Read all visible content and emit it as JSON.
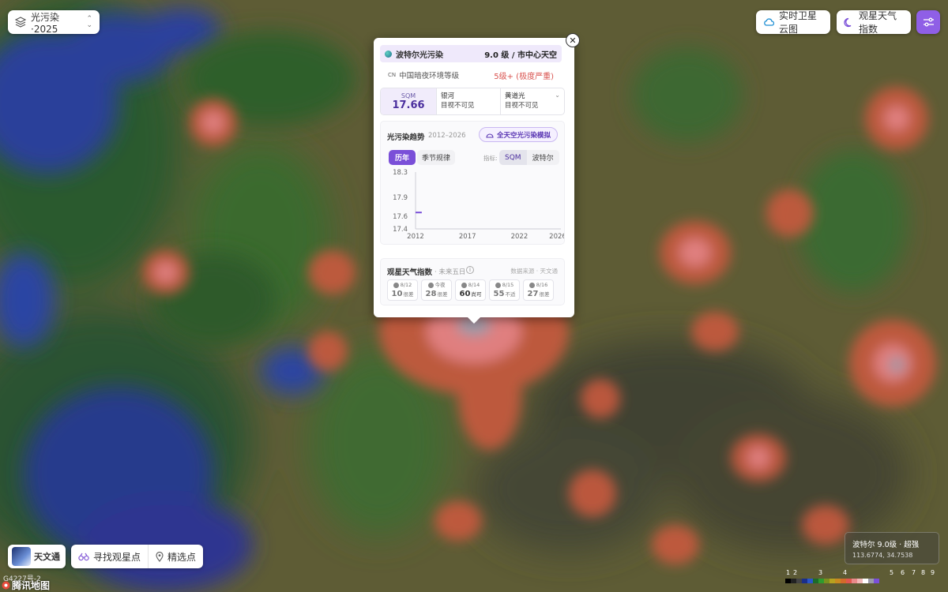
{
  "layer_selector": {
    "label": "光污染·2025"
  },
  "top_right": {
    "satellite_label": "实时卫星云图",
    "weather_label": "观星天气指数"
  },
  "popup": {
    "scale_name": "波特尔光污染",
    "scale_value": "9.0 级 / 市中心天空",
    "class_label": "中国暗夜环境等级",
    "class_flag": "CN",
    "class_value": "5级+ (极度严重)",
    "sqm_key": "SQM",
    "sqm_value": "17.66",
    "milkyway_label": "银河",
    "milkyway_value": "目视不可见",
    "zodiacal_label": "黄道光",
    "zodiacal_value": "目视不可见",
    "trend_title": "光污染趋势",
    "trend_range": "2012–2026",
    "trend_button": "全天空光污染模拟",
    "tabs": [
      "历年",
      "季节规律"
    ],
    "metric_label": "指标:",
    "metrics": [
      "SQM",
      "波特尔"
    ],
    "weather_title": "观星天气指数",
    "weather_sub": "· 未来五日",
    "weather_info": "i",
    "weather_source": "数据来源 · 天文通",
    "days": [
      {
        "date": "8/12",
        "score": "10",
        "label": "很差"
      },
      {
        "date": "今夜",
        "score": "28",
        "label": "很差"
      },
      {
        "date": "8/14",
        "score": "60",
        "label": "尚可"
      },
      {
        "date": "8/15",
        "score": "55",
        "label": "不适"
      },
      {
        "date": "8/16",
        "score": "27",
        "label": "很差"
      }
    ]
  },
  "chart_data": {
    "type": "line",
    "x": [
      2012,
      2012.2,
      2012.6
    ],
    "series": [
      {
        "values": [
          17.66,
          17.66,
          17.66
        ]
      }
    ],
    "xticks": [
      "2012",
      "2017",
      "2022",
      "2026"
    ],
    "yticks": [
      "18.3",
      "17.9",
      "17.6",
      "17.4"
    ],
    "xlim": [
      2012,
      2026
    ],
    "ylim": [
      17.4,
      18.3
    ],
    "title": "",
    "xlabel": "",
    "ylabel": ""
  },
  "bottom_left": {
    "app_label": "天文通",
    "find_label": "寻找观星点",
    "picks_label": "精选点",
    "road_code": "G4227号-2",
    "map_logo": "腾讯地图"
  },
  "info_box": {
    "line1": "波特尔 9.0级 · 超强",
    "line2": "113.6774, 34.7538"
  },
  "legend": {
    "labels": [
      "1",
      "2",
      "3",
      "4",
      "5",
      "6",
      "7",
      "8",
      "9"
    ],
    "colors": [
      "#000000",
      "#222222",
      "#444444",
      "#1a2f8a",
      "#2a55c8",
      "#1d6b2a",
      "#2f9a2f",
      "#7a8f1f",
      "#b7a21f",
      "#c88a1f",
      "#d46a2a",
      "#e0574f",
      "#e88a8a",
      "#f0b8b8",
      "#ffffff",
      "#9a9aa8",
      "#7a4fd8"
    ]
  }
}
